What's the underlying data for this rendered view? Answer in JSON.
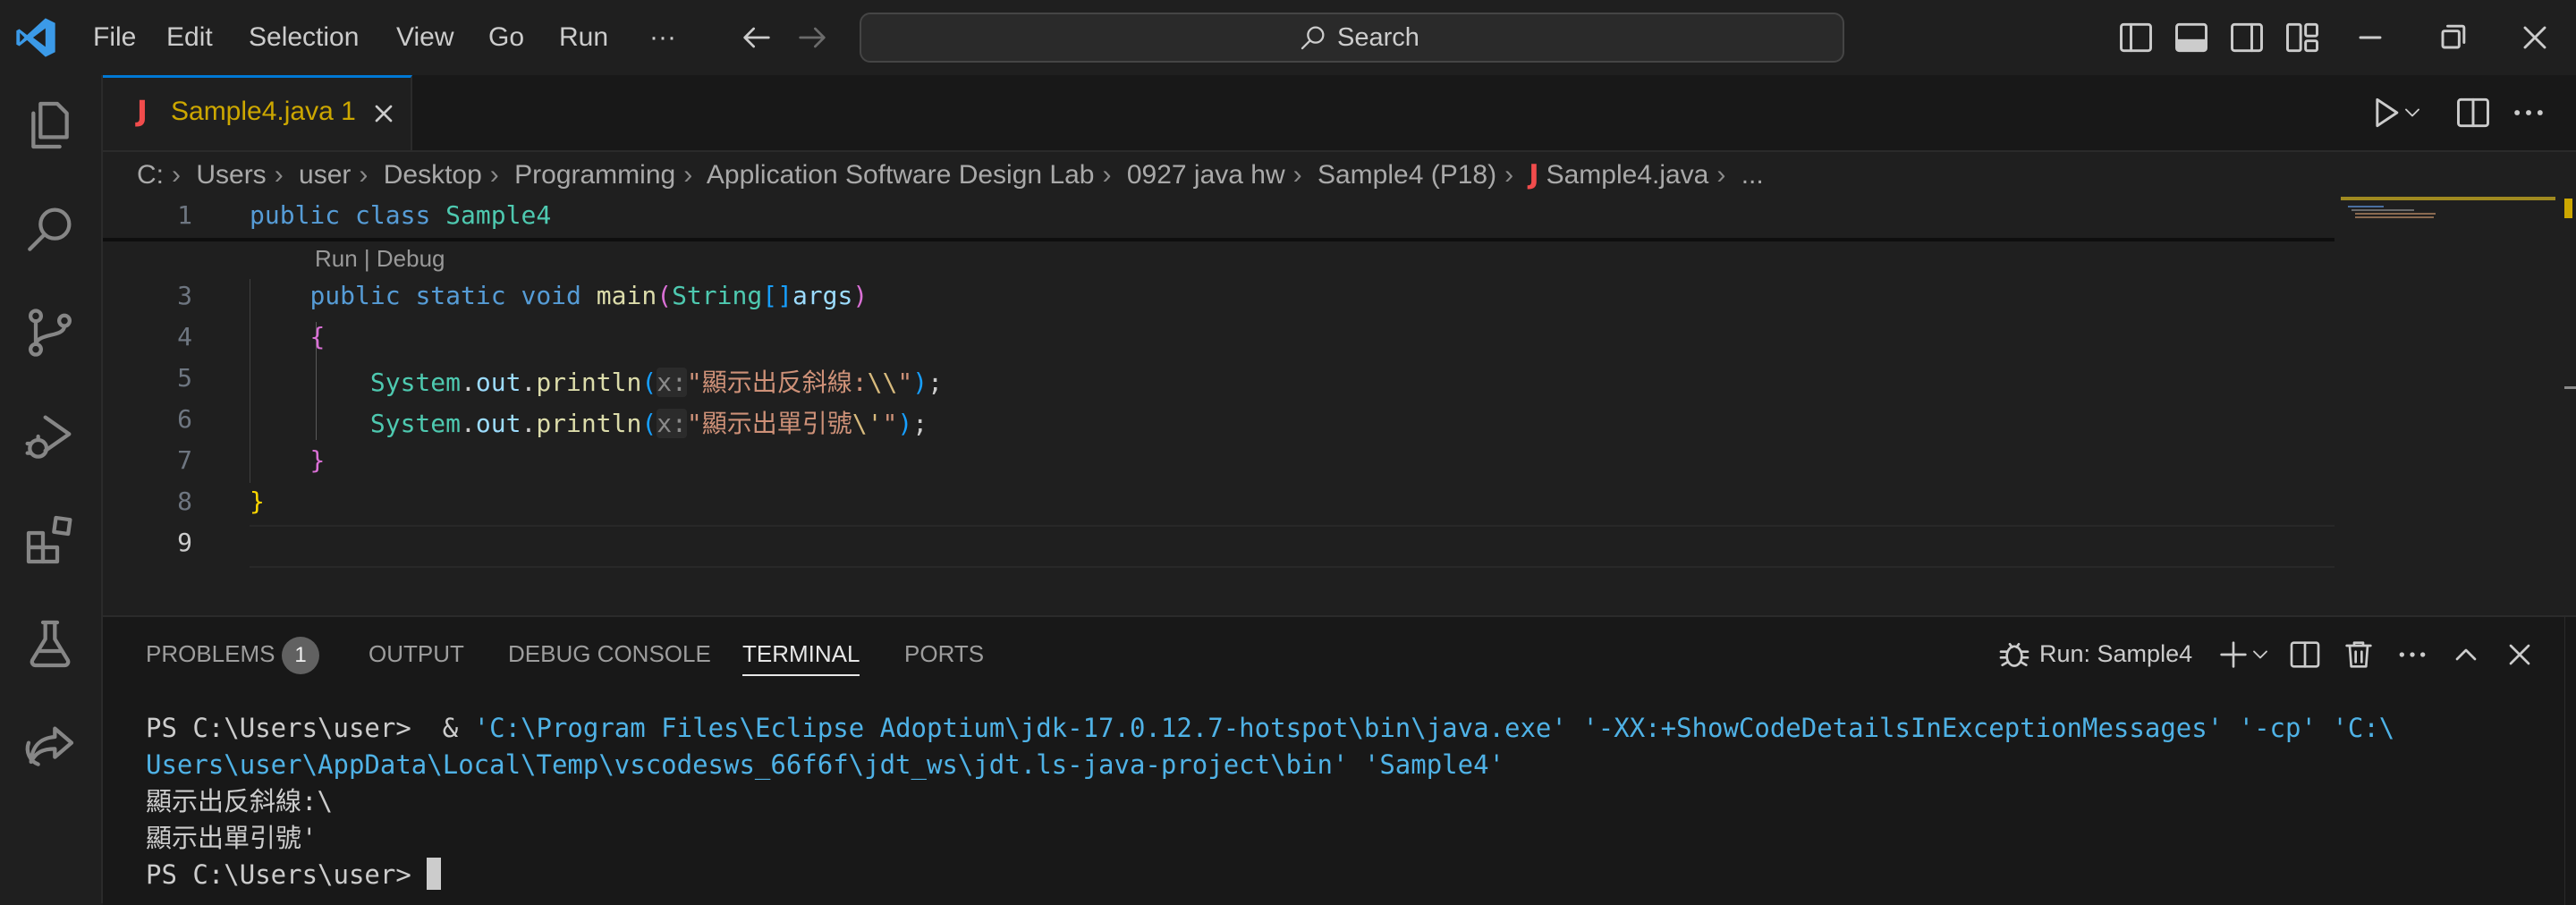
{
  "titlebar": {
    "menu": [
      "File",
      "Edit",
      "Selection",
      "View",
      "Go",
      "Run",
      "···"
    ],
    "search_label": "Search"
  },
  "tab": {
    "j_badge": "J",
    "name": "Sample4.java",
    "problems": "1"
  },
  "breadcrumb": [
    "C:",
    "Users",
    "user",
    "Desktop",
    "Programming",
    "Application Software Design Lab",
    "0927 java hw",
    "Sample4 (P18)",
    "Sample4.java",
    "..."
  ],
  "editor": {
    "line_numbers": [
      "1",
      "3",
      "4",
      "5",
      "6",
      "7",
      "8",
      "9"
    ],
    "codelens": "Run | Debug",
    "lines": {
      "l1": {
        "kw1": "public",
        "kw2": "class",
        "name": "Sample4"
      },
      "l3": {
        "kw1": "public",
        "kw2": "static",
        "kw3": "void",
        "fn": "main",
        "open": "(",
        "type": "String",
        "br": "[]",
        "arg": "args",
        "close": ")"
      },
      "l4": "{",
      "l5": {
        "obj": "System",
        "dot1": ".",
        "field": "out",
        "dot2": ".",
        "fn": "println",
        "open": "(",
        "hint": "x:",
        "str_a": "\"顯示出反斜線:",
        "esc": "\\\\",
        "str_b": "\"",
        "close": ")",
        "semi": ";"
      },
      "l6": {
        "obj": "System",
        "dot1": ".",
        "field": "out",
        "dot2": ".",
        "fn": "println",
        "open": "(",
        "hint": "x:",
        "str_a": "\"顯示出單引號",
        "esc": "\\'",
        "str_b": "\"",
        "close": ")",
        "semi": ";"
      },
      "l7": "}",
      "l8": "}"
    }
  },
  "panel": {
    "tabs": [
      "PROBLEMS",
      "OUTPUT",
      "DEBUG CONSOLE",
      "TERMINAL",
      "PORTS"
    ],
    "problems_count": "1",
    "active_tab": "TERMINAL",
    "run_label": "Run: Sample4",
    "terminal": {
      "prompt1": "PS C:\\Users\\user> ",
      "cmd_amp": " & ",
      "cmd_str1": "'C:\\Program Files\\Eclipse Adoptium\\jdk-17.0.12.7-hotspot\\bin\\java.exe'",
      "cmd_str2": "'-XX:+ShowCodeDetailsInExceptionMessages'",
      "cmd_str3": "'-cp'",
      "cmd_str4a": "'C:\\",
      "cmd_str4b": "Users\\user\\AppData\\Local\\Temp\\vscodesws_66f6f\\jdt_ws\\jdt.ls-java-project\\bin'",
      "cmd_str5": "'Sample4'",
      "out1": "顯示出反斜線:\\",
      "out2": "顯示出單引號'",
      "prompt2": "PS C:\\Users\\user> "
    }
  },
  "colors": {
    "accent": "#0078d4",
    "tab_modified": "#cca700",
    "java_icon": "#f14c4c",
    "terminal_string": "#4fb2e6"
  }
}
